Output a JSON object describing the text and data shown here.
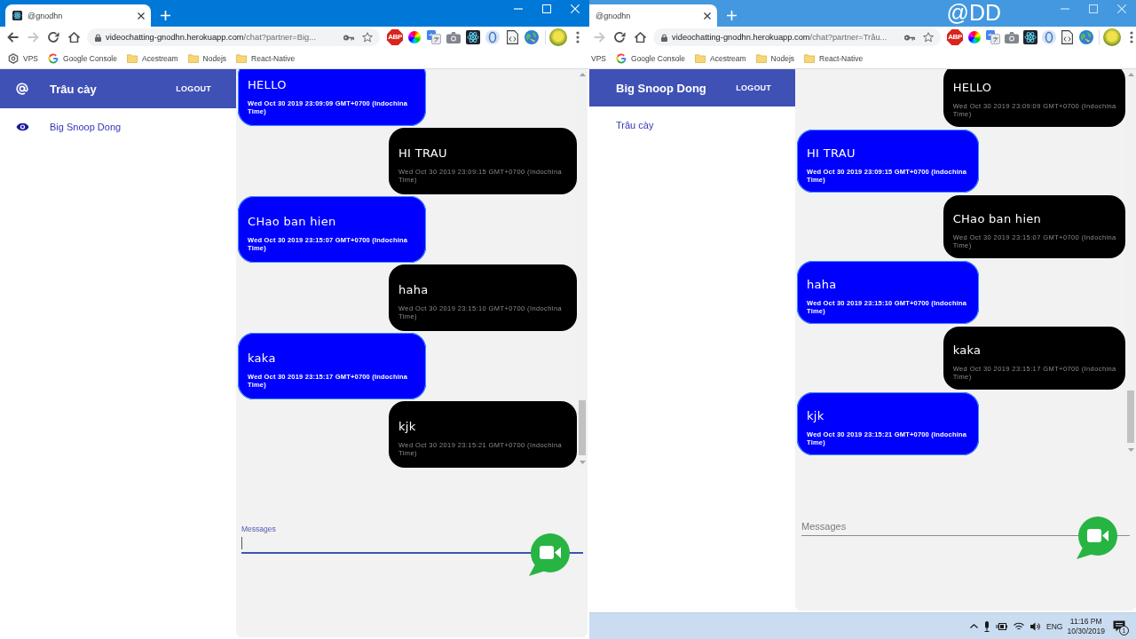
{
  "windows": [
    {
      "active": true,
      "tab": {
        "label": "@gnodhn",
        "favicon": true
      },
      "nav": [
        {
          "kind": "back",
          "disabled": false
        },
        {
          "kind": "forward",
          "disabled": true
        },
        {
          "kind": "reload",
          "disabled": false
        },
        {
          "kind": "home",
          "disabled": false
        }
      ],
      "address": {
        "host": "videochatting-gnodhn.herokuapp.com",
        "path": "/chat?partner=Big..."
      },
      "extensions": [
        {
          "kind": "adblock",
          "label": "ABP"
        },
        {
          "kind": "color-wheel"
        },
        {
          "kind": "translate"
        },
        {
          "kind": "camera"
        },
        {
          "kind": "atom"
        },
        {
          "kind": "ring"
        },
        {
          "kind": "page"
        },
        {
          "kind": "globe"
        }
      ],
      "bookmarks": [
        {
          "kind": "site",
          "label": "VPS"
        },
        {
          "kind": "google",
          "label": "Google Console"
        },
        {
          "kind": "folder",
          "label": "Acestream"
        },
        {
          "kind": "folder",
          "label": "Nodejs"
        },
        {
          "kind": "folder",
          "label": "React-Native"
        }
      ],
      "app": {
        "header": {
          "title": "Trâu cày",
          "icon": true,
          "action": "LOGOUT"
        },
        "contacts": [
          {
            "name": "Big Snoop Dong",
            "icon": true
          }
        ],
        "messages": [
          {
            "text": "HELLO",
            "time": "Wed Oct 30 2019 23:09:09 GMT+0700 (Indochina Time)",
            "mine": true
          },
          {
            "text": "HI TRAU",
            "time": "Wed Oct 30 2019 23:09:15 GMT+0700 (Indochina Time)",
            "mine": false
          },
          {
            "text": "CHao ban hien",
            "time": "Wed Oct 30 2019 23:15:07 GMT+0700 (Indochina Time)",
            "mine": true
          },
          {
            "text": "haha",
            "time": "Wed Oct 30 2019 23:15:10 GMT+0700 (Indochina Time)",
            "mine": false
          },
          {
            "text": "kaka",
            "time": "Wed Oct 30 2019 23:15:17 GMT+0700 (Indochina Time)",
            "mine": true
          },
          {
            "text": "kjk",
            "time": "Wed Oct 30 2019 23:15:21 GMT+0700 (Indochina Time)",
            "mine": false
          }
        ],
        "composer": {
          "label": "Messages",
          "focused": true
        }
      }
    },
    {
      "active": false,
      "caption": "@DD",
      "tab": {
        "label": "@gnodhn",
        "favicon": false
      },
      "nav": [
        {
          "kind": "forward",
          "disabled": true
        },
        {
          "kind": "reload",
          "disabled": false
        },
        {
          "kind": "home",
          "disabled": false
        }
      ],
      "address": {
        "host": "videochatting-gnodhn.herokuapp.com",
        "path": "/chat?partner=Trâu..."
      },
      "extensions": [
        {
          "kind": "adblock",
          "label": "ABP"
        },
        {
          "kind": "color-wheel"
        },
        {
          "kind": "translate"
        },
        {
          "kind": "camera"
        },
        {
          "kind": "atom"
        },
        {
          "kind": "ring"
        },
        {
          "kind": "page"
        },
        {
          "kind": "globe"
        }
      ],
      "bookmarks": [
        {
          "kind": "text",
          "label": "VPS"
        },
        {
          "kind": "google",
          "label": "Google Console"
        },
        {
          "kind": "folder",
          "label": "Acestream"
        },
        {
          "kind": "folder",
          "label": "Nodejs"
        },
        {
          "kind": "folder",
          "label": "React-Native"
        }
      ],
      "app": {
        "header": {
          "title": "Big Snoop Dong",
          "icon": false,
          "action": "LOGOUT"
        },
        "contacts": [
          {
            "name": "Trâu cày",
            "icon": false
          }
        ],
        "messages": [
          {
            "text": "HELLO",
            "time": "Wed Oct 30 2019 23:09:09 GMT+0700 (Indochina Time)",
            "mine": false
          },
          {
            "text": "HI TRAU",
            "time": "Wed Oct 30 2019 23:09:15 GMT+0700 (Indochina Time)",
            "mine": true
          },
          {
            "text": "CHao ban hien",
            "time": "Wed Oct 30 2019 23:15:07 GMT+0700 (Indochina Time)",
            "mine": false
          },
          {
            "text": "haha",
            "time": "Wed Oct 30 2019 23:15:10 GMT+0700 (Indochina Time)",
            "mine": true
          },
          {
            "text": "kaka",
            "time": "Wed Oct 30 2019 23:15:17 GMT+0700 (Indochina Time)",
            "mine": false
          },
          {
            "text": "kjk",
            "time": "Wed Oct 30 2019 23:15:21 GMT+0700 (Indochina Time)",
            "mine": true
          }
        ],
        "composer": {
          "label": "Messages",
          "focused": false
        }
      }
    }
  ],
  "taskbar": {
    "language": "ENG",
    "time": "11:16 PM",
    "date": "10/30/2019",
    "notifications": "1"
  }
}
